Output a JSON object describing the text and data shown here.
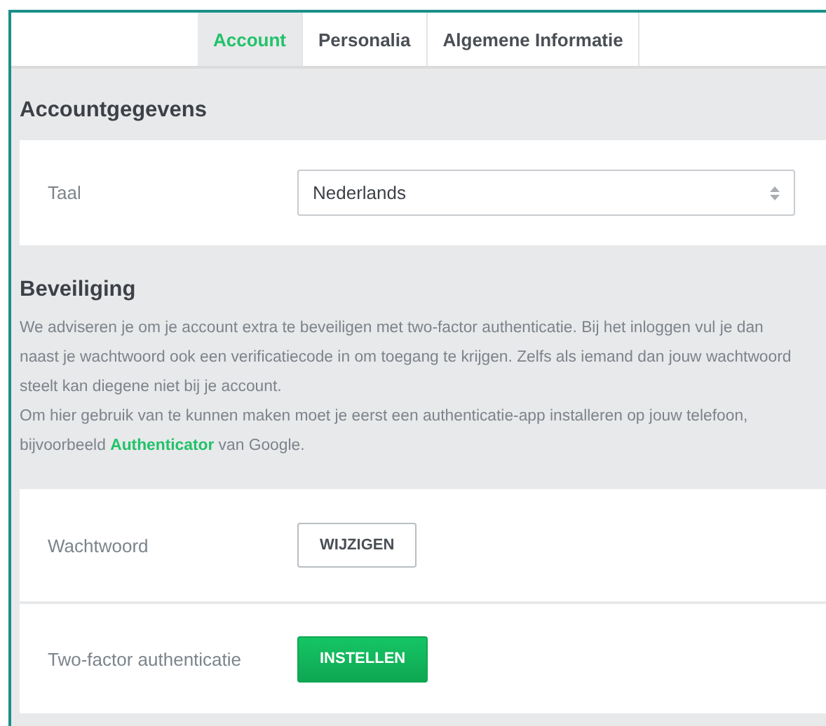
{
  "tabs": [
    {
      "label": "Account",
      "selected": true
    },
    {
      "label": "Personalia",
      "selected": false
    },
    {
      "label": "Algemene Informatie",
      "selected": false
    }
  ],
  "account": {
    "heading": "Accountgegevens",
    "language": {
      "label": "Taal",
      "value": "Nederlands"
    }
  },
  "security": {
    "heading": "Beveiliging",
    "intro": "We adviseren je om je account extra te beveiligen met two-factor authenticatie. Bij het inloggen vul je dan naast je wachtwoord ook een verificatiecode in om toegang te krijgen. Zelfs als iemand dan jouw wachtwoord steelt kan diegene niet bij je account.",
    "note": {
      "before": "Om hier gebruik van te kunnen maken moet je eerst een authenticatie-app installeren op jouw telefoon, bijvoorbeeld ",
      "link": "Authenticator",
      "after": " van Google."
    },
    "rows": [
      {
        "label": "Wachtwoord",
        "button": "WIJZIGEN",
        "kind": "outline"
      },
      {
        "label": "Two-factor authenticatie",
        "button": "INSTELLEN",
        "kind": "primary"
      }
    ]
  }
}
